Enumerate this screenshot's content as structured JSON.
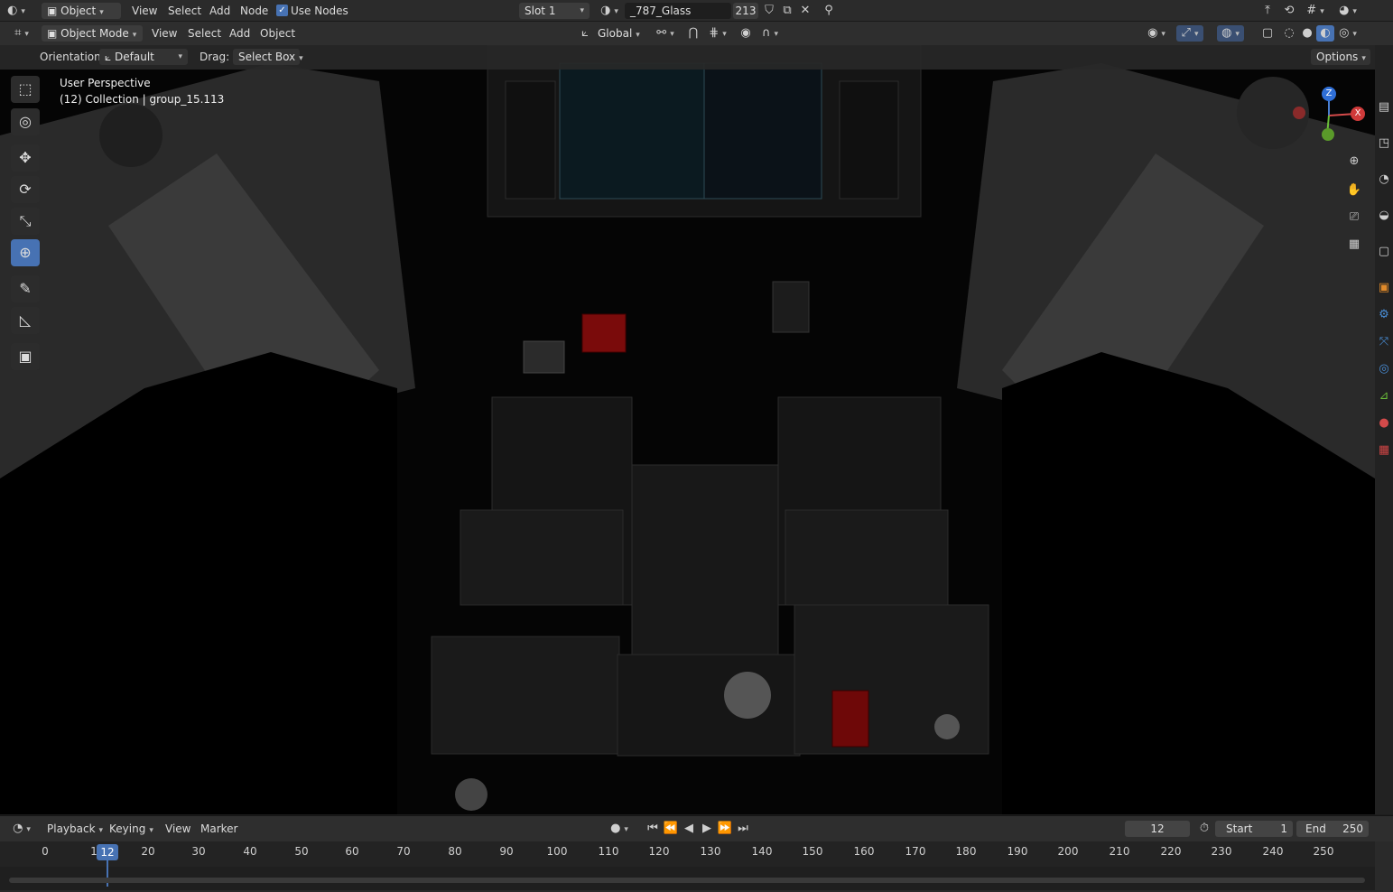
{
  "header1": {
    "mode_label": "Object",
    "menus": [
      "View",
      "Select",
      "Add",
      "Node"
    ],
    "use_nodes_label": "Use Nodes",
    "use_nodes_checked": true,
    "slot_label": "Slot 1",
    "material_name": "_787_Glass",
    "user_count": "213"
  },
  "header2": {
    "mode_label": "Object Mode",
    "menus": [
      "View",
      "Select",
      "Add",
      "Object"
    ],
    "transform_orientation": "Global"
  },
  "header3": {
    "orientation_label": "Orientation:",
    "orientation_value": "Default",
    "drag_label": "Drag:",
    "drag_value": "Select Box",
    "options_label": "Options"
  },
  "viewport": {
    "perspective_label": "User Perspective",
    "collection_label": "(12) Collection | group_15.113",
    "gizmo_z": "Z",
    "gizmo_x": "X"
  },
  "tools": [
    {
      "name": "select-box-tool",
      "glyph": "⬚",
      "active": false
    },
    {
      "name": "cursor-tool",
      "glyph": "◎",
      "active": false
    },
    {
      "name": "move-tool",
      "glyph": "✥",
      "active": false
    },
    {
      "name": "rotate-tool",
      "glyph": "⟳",
      "active": false
    },
    {
      "name": "scale-tool",
      "glyph": "⤡",
      "active": false
    },
    {
      "name": "transform-tool",
      "glyph": "⊕",
      "active": true
    },
    {
      "name": "annotate-tool",
      "glyph": "✎",
      "active": false
    },
    {
      "name": "measure-tool",
      "glyph": "◺",
      "active": false
    },
    {
      "name": "add-cube-tool",
      "glyph": "▣",
      "active": false
    }
  ],
  "timeline": {
    "menus": [
      "Playback",
      "Keying",
      "View",
      "Marker"
    ],
    "current_frame": "12",
    "start_label": "Start",
    "start_value": "1",
    "end_label": "End",
    "end_value": "250",
    "ruler_ticks": [
      "0",
      "1",
      "20",
      "30",
      "40",
      "50",
      "60",
      "70",
      "80",
      "90",
      "100",
      "110",
      "120",
      "130",
      "140",
      "150",
      "160",
      "170",
      "180",
      "190",
      "200",
      "210",
      "220",
      "230",
      "240",
      "250"
    ],
    "playhead_label": "12"
  },
  "colors": {
    "accent": "#4772b3",
    "header_bg": "#2b2b2b",
    "viewport_bg": "#070707"
  }
}
